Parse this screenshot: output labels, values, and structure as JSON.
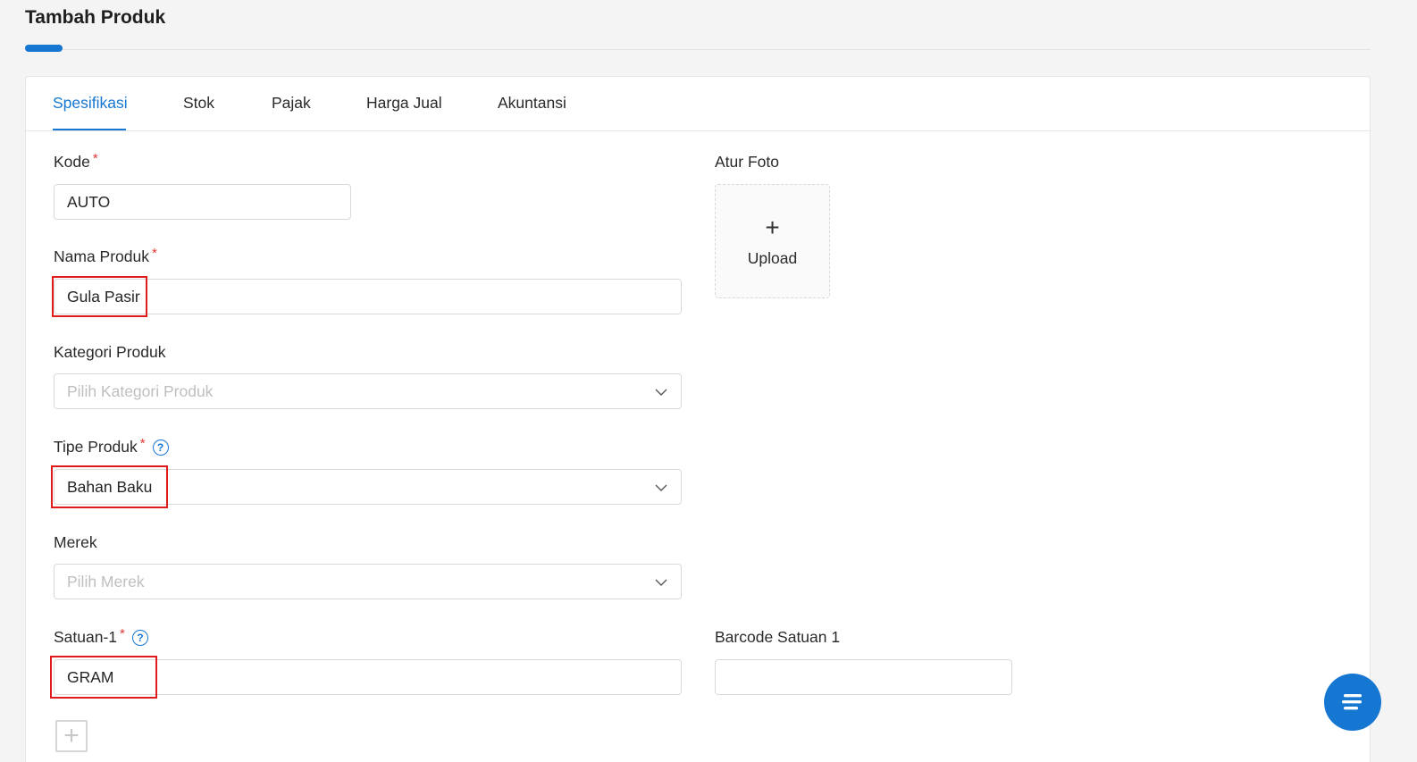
{
  "page": {
    "title": "Tambah Produk"
  },
  "tabs": [
    {
      "label": "Spesifikasi",
      "active": true
    },
    {
      "label": "Stok",
      "active": false
    },
    {
      "label": "Pajak",
      "active": false
    },
    {
      "label": "Harga Jual",
      "active": false
    },
    {
      "label": "Akuntansi",
      "active": false
    }
  ],
  "form": {
    "kode": {
      "label": "Kode",
      "required": "*",
      "value": "AUTO"
    },
    "nama_produk": {
      "label": "Nama Produk",
      "required": "*",
      "value": "Gula Pasir"
    },
    "kategori_produk": {
      "label": "Kategori Produk",
      "placeholder": "Pilih Kategori Produk"
    },
    "tipe_produk": {
      "label": "Tipe Produk",
      "required": "*",
      "value": "Bahan Baku"
    },
    "merek": {
      "label": "Merek",
      "placeholder": "Pilih Merek"
    },
    "satuan_1": {
      "label": "Satuan-1",
      "required": "*",
      "value": "GRAM"
    },
    "barcode_satuan_1": {
      "label": "Barcode Satuan 1",
      "value": ""
    },
    "atur_foto": {
      "label": "Atur Foto",
      "upload_label": "Upload",
      "upload_icon": "+"
    },
    "add_unit_icon": "+",
    "help_icon": "?"
  },
  "colors": {
    "accent": "#1677d3",
    "highlight": "#e01b1b",
    "required": "#e53935"
  },
  "icons": {
    "help": "question-circle-icon",
    "dropdown": "chevron-down-icon",
    "add": "plus-icon",
    "chat": "chat-icon"
  }
}
